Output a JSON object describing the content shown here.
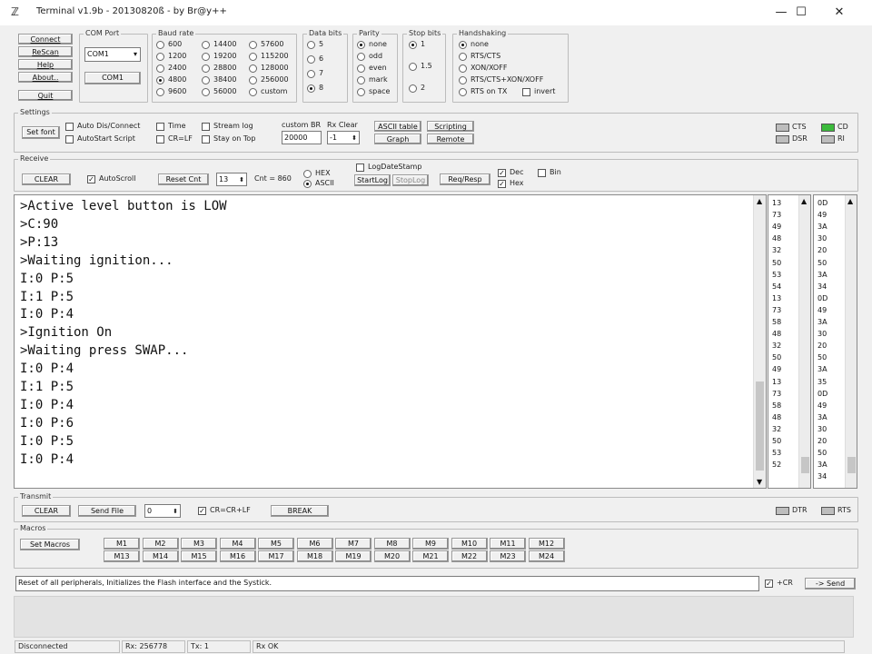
{
  "window": {
    "title": "Terminal v1.9b - 20130820ß - by Br@y++",
    "minimize": "—",
    "maximize": "☐",
    "close": "✕"
  },
  "left_buttons": [
    "Connect",
    "ReScan",
    "Help",
    "About..",
    "Quit"
  ],
  "com_port": {
    "label": "COM Port",
    "value": "COM1",
    "button": "COM1"
  },
  "baud": {
    "label": "Baud rate",
    "col1": [
      "600",
      "1200",
      "2400",
      "4800",
      "9600"
    ],
    "col2": [
      "14400",
      "19200",
      "28800",
      "38400",
      "56000"
    ],
    "col3": [
      "57600",
      "115200",
      "128000",
      "256000",
      "custom"
    ],
    "selected": "4800"
  },
  "databits": {
    "label": "Data bits",
    "options": [
      "5",
      "6",
      "7",
      "8"
    ],
    "selected": "8"
  },
  "parity": {
    "label": "Parity",
    "options": [
      "none",
      "odd",
      "even",
      "mark",
      "space"
    ],
    "selected": "none"
  },
  "stopbits": {
    "label": "Stop bits",
    "options": [
      "1",
      "1.5",
      "2"
    ],
    "selected": "1"
  },
  "handshaking": {
    "label": "Handshaking",
    "options": [
      "none",
      "RTS/CTS",
      "XON/XOFF",
      "RTS/CTS+XON/XOFF",
      "RTS on TX"
    ],
    "invert": "invert",
    "selected": "none"
  },
  "settings": {
    "label": "Settings",
    "set_font": "Set font",
    "checks_a": [
      "Auto Dis/Connect",
      "AutoStart Script"
    ],
    "checks_b": [
      "Time",
      "CR=LF"
    ],
    "checks_c": [
      "Stream log",
      "Stay on Top"
    ],
    "custom_br_label": "custom BR",
    "custom_br": "20000",
    "rx_clear_label": "Rx Clear",
    "rx_clear": "-1",
    "ascii_table": "ASCII table",
    "graph": "Graph",
    "scripting": "Scripting",
    "remote": "Remote"
  },
  "signals": {
    "cts": "CTS",
    "cd": "CD",
    "dsr": "DSR",
    "ri": "RI"
  },
  "receive": {
    "label": "Receive",
    "clear": "CLEAR",
    "autoscroll": "AutoScroll",
    "reset_cnt": "Reset Cnt",
    "cnt_value": "13",
    "cnt_label": "Cnt = 860",
    "hex": "HEX",
    "ascii": "ASCII",
    "startlog": "StartLog",
    "stoplog": "StopLog",
    "logdatestamp": "LogDateStamp",
    "reqresp": "Req/Resp",
    "dec": "Dec",
    "bin": "Bin",
    "hex_chk": "Hex"
  },
  "terminal_lines": [
    ">Active level button is LOW",
    ">C:90",
    ">P:13",
    ">Waiting ignition...",
    "I:0 P:5",
    "I:1 P:5",
    "I:0 P:4",
    ">Ignition On",
    ">Waiting press SWAP...",
    "I:0 P:4",
    "I:1 P:5",
    "I:0 P:4",
    "I:0 P:6",
    "I:0 P:5",
    "I:0 P:4"
  ],
  "dec_col": [
    "13",
    "73",
    "49",
    "48",
    "32",
    "50",
    "53",
    "54",
    "13",
    "73",
    "58",
    "48",
    "32",
    "50",
    "49",
    "13",
    "73",
    "58",
    "48",
    "32",
    "50",
    "53",
    "52"
  ],
  "hex_col": [
    "0D",
    "49",
    "3A",
    "30",
    "20",
    "50",
    "3A",
    "34",
    "0D",
    "49",
    "3A",
    "30",
    "20",
    "50",
    "3A",
    "35",
    "0D",
    "49",
    "3A",
    "30",
    "20",
    "50",
    "3A",
    "34"
  ],
  "transmit": {
    "label": "Transmit",
    "clear": "CLEAR",
    "send_file": "Send File",
    "counter": "0",
    "crcrlf": "CR=CR+LF",
    "break": "BREAK",
    "dtr": "DTR",
    "rts": "RTS"
  },
  "macros": {
    "label": "Macros",
    "set_macros": "Set Macros",
    "top": [
      "M1",
      "M2",
      "M3",
      "M4",
      "M5",
      "M6",
      "M7",
      "M8",
      "M9",
      "M10",
      "M11",
      "M12"
    ],
    "bottom": [
      "M13",
      "M14",
      "M15",
      "M16",
      "M17",
      "M18",
      "M19",
      "M20",
      "M21",
      "M22",
      "M23",
      "M24"
    ]
  },
  "send": {
    "value": "Reset of all peripherals, Initializes the Flash interface and the Systick.",
    "cr": "+CR",
    "send": "-> Send"
  },
  "status": {
    "conn": "Disconnected",
    "rx": "Rx: 256778",
    "tx": "Tx: 1",
    "ok": "Rx OK"
  }
}
